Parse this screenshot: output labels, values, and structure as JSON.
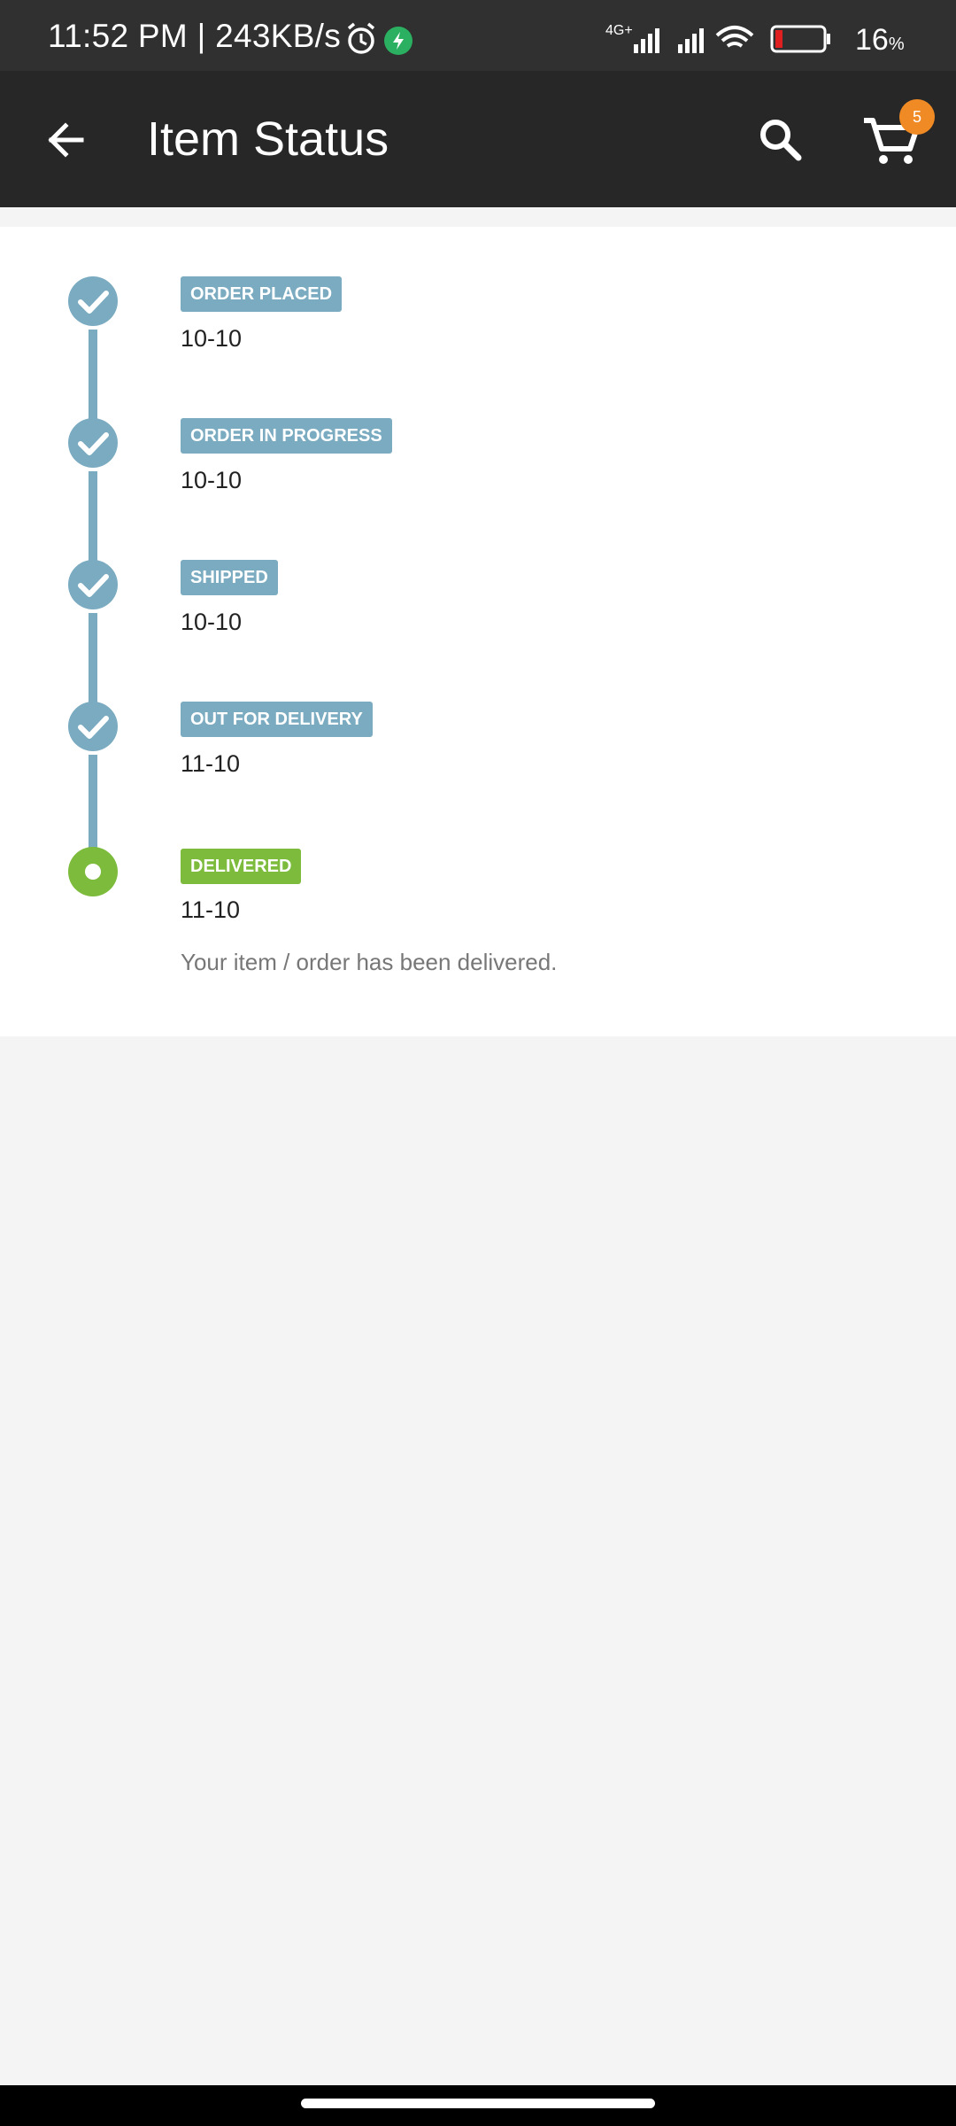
{
  "status_bar": {
    "time_speed": "11:52 PM | 243KB/s",
    "network_label": "4G+",
    "battery_percent": "16",
    "battery_unit": "%",
    "battery_level": 0.16
  },
  "app_bar": {
    "title": "Item Status",
    "cart_count": "5"
  },
  "timeline": {
    "steps": [
      {
        "label": "ORDER PLACED",
        "date": "10-10",
        "state": "done"
      },
      {
        "label": "ORDER IN PROGRESS",
        "date": "10-10",
        "state": "done"
      },
      {
        "label": "SHIPPED",
        "date": "10-10",
        "state": "done"
      },
      {
        "label": "OUT FOR DELIVERY",
        "date": "11-10",
        "state": "done"
      },
      {
        "label": "DELIVERED",
        "date": "11-10",
        "state": "current",
        "note": "Your item / order has been delivered."
      }
    ]
  },
  "colors": {
    "done": "#7aabc1",
    "current": "#7cbb3b",
    "badge": "#f08a24",
    "app_bar": "#272727"
  },
  "icons": {
    "back": "arrow-left-icon",
    "search": "search-icon",
    "cart": "shopping-cart-icon",
    "done_step": "check-icon",
    "current_step": "radio-dot-icon"
  }
}
